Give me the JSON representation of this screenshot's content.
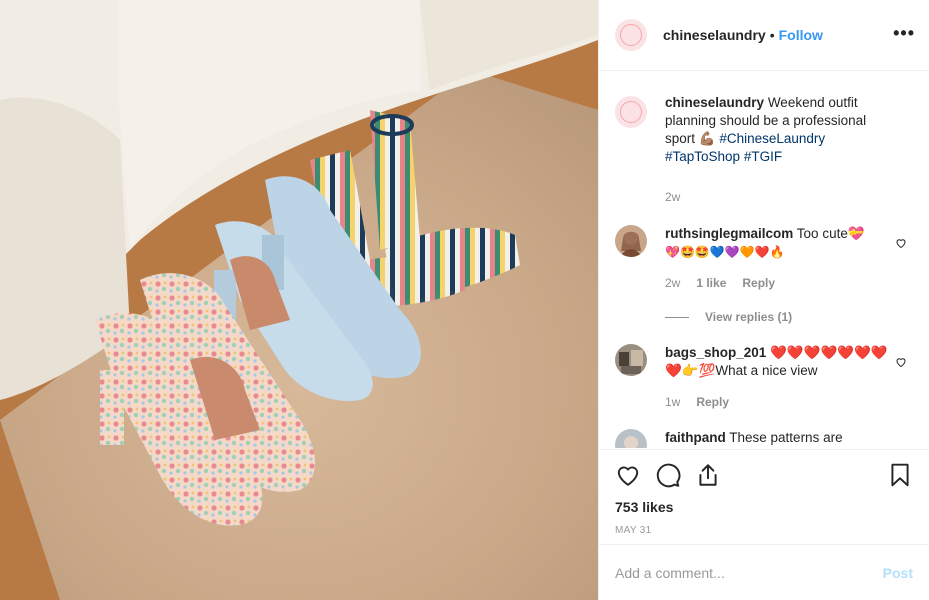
{
  "post": {
    "author": "chineselaundry",
    "separator": "•",
    "follow_label": "Follow",
    "more_label": "•••",
    "caption_text": "Weekend outfit planning should be a professional sport 💪🏽",
    "hashtags": [
      "#ChineseLaundry",
      "#TapToShop",
      "#TGIF"
    ],
    "caption_age": "2w",
    "likes": "753 likes",
    "date": "MAY 31",
    "photo_alt": "Three pairs of block-heel sandals on a rug"
  },
  "comments": [
    {
      "user": "ruthsinglegmailcom",
      "text": "Too cute💝",
      "emojis": "💖🤩🤩💙💜🧡❤️🔥",
      "age": "2w",
      "likes": "1 like",
      "reply_label": "Reply",
      "view_replies": "View replies (1)"
    },
    {
      "user": "bags_shop_201",
      "text": "❤️❤️❤️❤️❤️❤️❤️❤️👉💯What a nice view",
      "age": "1w",
      "reply_label": "Reply"
    },
    {
      "user": "faithpand",
      "text": "These patterns are"
    }
  ],
  "add_comment": {
    "placeholder": "Add a comment...",
    "post_label": "Post"
  },
  "colors": {
    "link": "#3897f0",
    "hashtag": "#003569",
    "post_disabled": "#b2dffc",
    "brand_avatar": "#fbe3e5"
  },
  "icons": [
    "heart-icon",
    "comment-icon",
    "share-icon",
    "bookmark-icon",
    "ellipsis-icon"
  ]
}
